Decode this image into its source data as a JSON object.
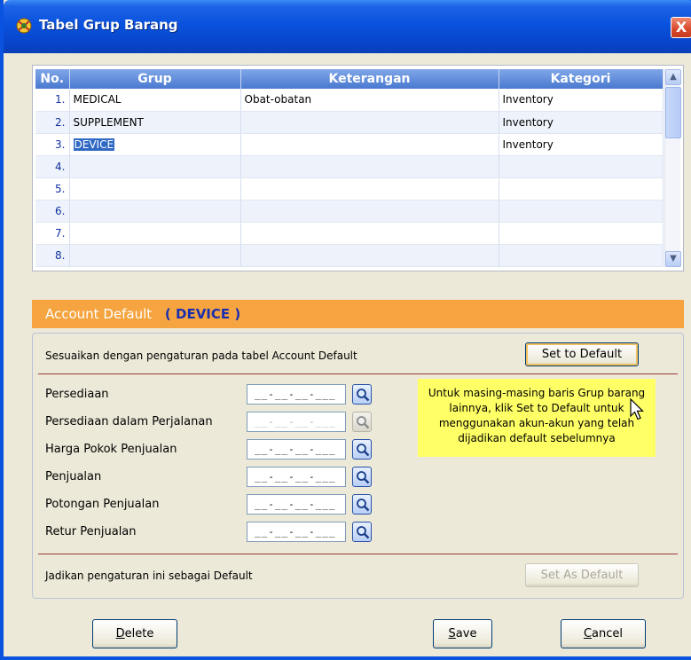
{
  "window": {
    "title": "Tabel Grup Barang",
    "close_label": "X"
  },
  "grid": {
    "headers": [
      "No.",
      "Grup",
      "Keterangan",
      "Kategori"
    ],
    "rows": [
      {
        "no": "1.",
        "grup": "MEDICAL",
        "keterangan": "Obat-obatan",
        "kategori": "Inventory"
      },
      {
        "no": "2.",
        "grup": "SUPPLEMENT",
        "keterangan": "",
        "kategori": "Inventory"
      },
      {
        "no": "3.",
        "grup": "DEVICE",
        "keterangan": "",
        "kategori": "Inventory"
      },
      {
        "no": "4.",
        "grup": "",
        "keterangan": "",
        "kategori": ""
      },
      {
        "no": "5.",
        "grup": "",
        "keterangan": "",
        "kategori": ""
      },
      {
        "no": "6.",
        "grup": "",
        "keterangan": "",
        "kategori": ""
      },
      {
        "no": "7.",
        "grup": "",
        "keterangan": "",
        "kategori": ""
      },
      {
        "no": "8.",
        "grup": "",
        "keterangan": "",
        "kategori": ""
      }
    ],
    "selected_row": 3
  },
  "account_default": {
    "title": "Account Default",
    "group": "( DEVICE )",
    "sync_hint": "Sesuaikan dengan pengaturan pada tabel Account Default",
    "set_to_default": "Set to Default",
    "fields": [
      {
        "label": "Persediaan",
        "value": "__-__-__-___",
        "enabled": true
      },
      {
        "label": "Persediaan dalam Perjalanan",
        "value": "__-__-__-___",
        "enabled": false
      },
      {
        "label": "Harga Pokok Penjualan",
        "value": "__-__-__-___",
        "enabled": true
      },
      {
        "label": "Penjualan",
        "value": "__-__-__-___",
        "enabled": true
      },
      {
        "label": "Potongan Penjualan",
        "value": "__-__-__-___",
        "enabled": true
      },
      {
        "label": "Retur Penjualan",
        "value": "__-__-__-___",
        "enabled": true
      }
    ],
    "tooltip": "Untuk masing-masing baris Grup barang lainnya, klik Set to Default untuk menggunakan akun-akun yang telah dijadikan default sebelumnya",
    "make_default_hint": "Jadikan pengaturan ini sebagai Default",
    "set_as_default": "Set As Default"
  },
  "buttons": {
    "delete_first": "D",
    "delete_rest": "elete",
    "save_first": "S",
    "save_rest": "ave",
    "cancel_first": "C",
    "cancel_rest": "ancel"
  },
  "colors": {
    "title_bar": "#0a52de",
    "header_orange": "#f5a43f",
    "tooltip": "#ffff66",
    "grid_header": "#4a79cf",
    "selection": "#316ac5"
  },
  "icons": [
    "app-icon",
    "close-icon",
    "scroll-up-icon",
    "scroll-down-icon",
    "magnifier-icon",
    "cursor-icon"
  ]
}
